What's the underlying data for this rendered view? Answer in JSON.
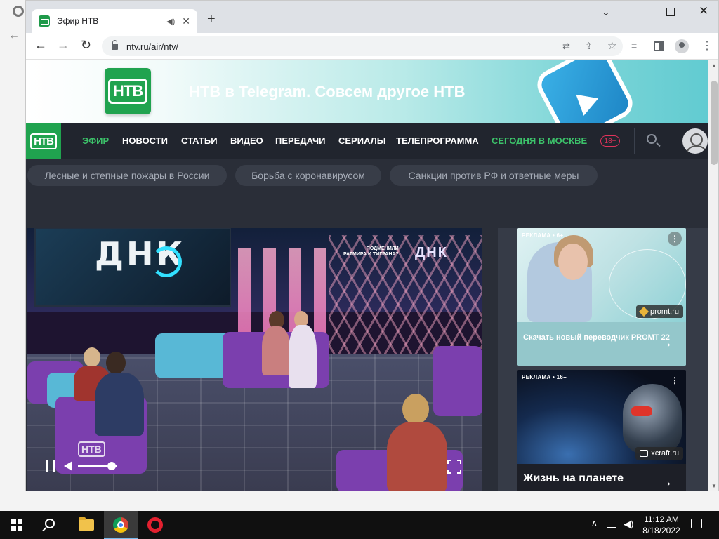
{
  "browser": {
    "tab_title": "Эфир НТВ",
    "tab_audio_icon": "speaker-icon",
    "new_tab_label": "+",
    "url": "ntv.ru/air/ntv/",
    "window_controls": [
      "chevron-down-icon",
      "minimize-icon",
      "maximize-icon",
      "close-icon"
    ]
  },
  "banner": {
    "logo_text": "НТВ",
    "text": "НТВ в Telegram. Совсем другое НТВ"
  },
  "site_nav": {
    "logo_text": "НТВ",
    "items": [
      {
        "label": "ЭФИР",
        "active": true
      },
      {
        "label": "НОВОСТИ"
      },
      {
        "label": "СТАТЬИ"
      },
      {
        "label": "ВИДЕО"
      },
      {
        "label": "ПЕРЕДАЧИ"
      },
      {
        "label": "СЕРИАЛЫ"
      },
      {
        "label": "ТЕЛЕПРОГРАММА"
      },
      {
        "label": "СЕГОДНЯ В МОСКВЕ",
        "highlight": true
      }
    ],
    "age_badge": "18+"
  },
  "topics": [
    "Лесные и степные пожары в России",
    "Борьба с коронавирусом",
    "Санкции против РФ и ответные меры"
  ],
  "player": {
    "show_title": "ДНК",
    "promo_line1": "ПОДМЕНИЛИ",
    "promo_line2": "РАТМИРА И ТИГРАНА?",
    "promo_logo": "ДНК",
    "watermark": "НТВ",
    "volume": 0.85
  },
  "ads": [
    {
      "label": "РЕКЛАМА • 6+",
      "brand": "promt.ru",
      "cta": "Скачать новый переводчик PROMT 22",
      "arrow": "→"
    },
    {
      "label": "РЕКЛАМА • 16+",
      "brand": "xcraft.ru",
      "title": "Жизнь на планете",
      "arrow": "→"
    }
  ],
  "taskbar": {
    "time": "11:12 AM",
    "date": "8/18/2022"
  },
  "colors": {
    "brand_green": "#20a34f",
    "nav_bg": "#21252e",
    "page_bg": "#2a2e38",
    "active_green": "#3cc26a",
    "badge_red": "#e0335a"
  }
}
